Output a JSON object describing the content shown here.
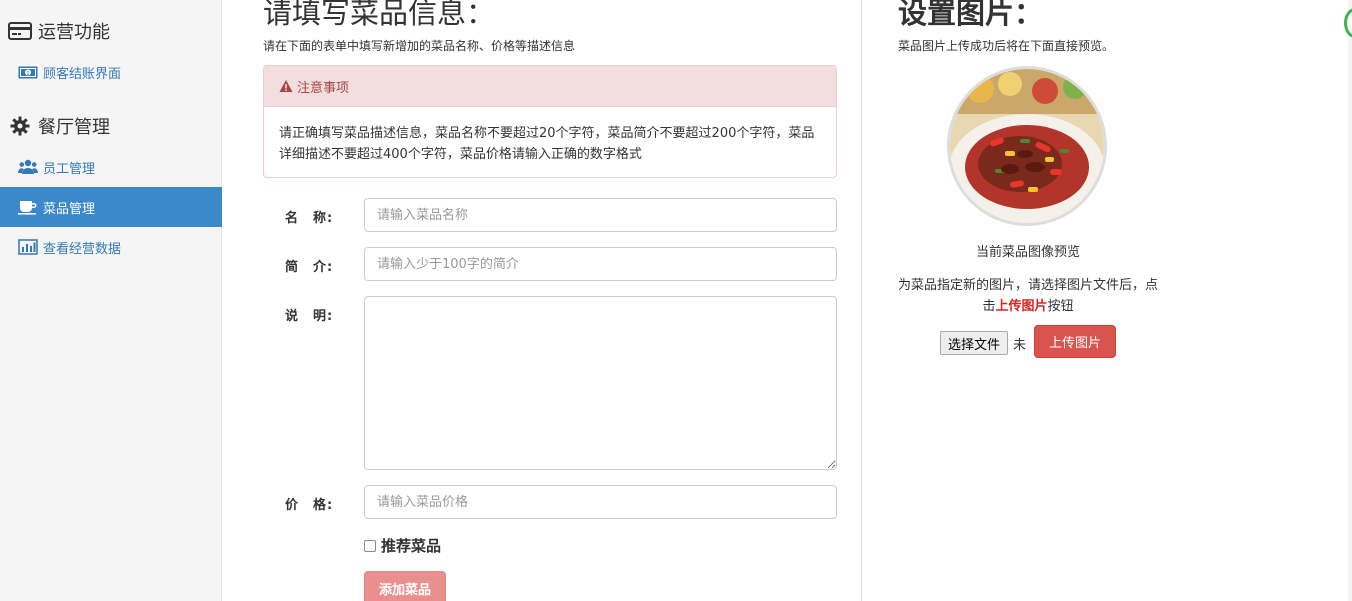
{
  "sidebar": {
    "section1": {
      "title": "运营功能",
      "icon": "credit-card-icon"
    },
    "checkout": {
      "label": "顾客结账界面",
      "icon": "money-icon"
    },
    "section2": {
      "title": "餐厅管理",
      "icon": "gear-icon"
    },
    "items": [
      {
        "label": "员工管理",
        "icon": "users-icon"
      },
      {
        "label": "菜品管理",
        "icon": "cup-icon",
        "active": true
      },
      {
        "label": "查看经营数据",
        "icon": "bar-chart-icon"
      }
    ]
  },
  "form": {
    "title": "请填写菜品信息：",
    "subtitle": "请在下面的表单中填写新增加的菜品名称、价格等描述信息",
    "notice": {
      "heading": "注意事项",
      "body": "请正确填写菜品描述信息，菜品名称不要超过20个字符，菜品简介不要超过200个字符，菜品详细描述不要超过400个字符，菜品价格请输入正确的数字格式"
    },
    "name": {
      "label": "名　称:",
      "placeholder": "请输入菜品名称",
      "value": ""
    },
    "brief": {
      "label": "简　介:",
      "placeholder": "请输入少于100字的简介",
      "value": ""
    },
    "desc": {
      "label": "说　明:",
      "value": ""
    },
    "price": {
      "label": "价　格:",
      "placeholder": "请输入菜品价格",
      "value": ""
    },
    "recommend": {
      "label": "推荐菜品",
      "checked": false
    },
    "submit_label": "添加菜品"
  },
  "image": {
    "title": "设置图片：",
    "subtitle": "菜品图片上传成功后将在下面直接预览。",
    "preview_caption": "当前菜品图像预览",
    "instr_prefix": "为菜品指定新的图片，请选择图片文件后，点击",
    "instr_highlight": "上传图片",
    "instr_suffix": "按钮",
    "choose_file_label": "选择文件",
    "file_state": "未",
    "upload_label": "上传图片"
  },
  "colors": {
    "accent": "#3b89c9",
    "danger": "#d9534f",
    "danger_light": "#e9908e",
    "notice_bg": "#f2dede",
    "notice_text": "#a94442",
    "link": "#337ab7"
  }
}
